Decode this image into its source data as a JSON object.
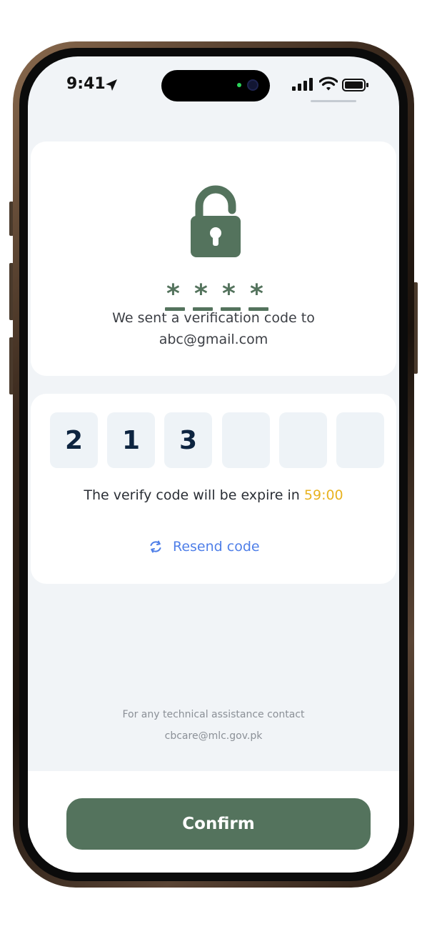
{
  "status_bar": {
    "time": "9:41"
  },
  "verification": {
    "sent_line1": "We sent a verification code to",
    "sent_line2": "abc@gmail.com",
    "mask_chars": [
      "*",
      "*",
      "*",
      "*"
    ]
  },
  "otp": {
    "digits": [
      "2",
      "1",
      "3",
      "",
      "",
      ""
    ],
    "expire_prefix": "The verify code will be expire in",
    "expire_time": "59:00",
    "resend_label": "Resend code"
  },
  "help": {
    "line1": "For any technical assistance contact",
    "line2": "cbcare@mlc.gov.pk"
  },
  "footer": {
    "confirm_label": "Confirm"
  },
  "colors": {
    "accent": "#54735d",
    "timer": "#e8b321",
    "link": "#4f7fe8",
    "screen_bg": "#f1f4f7"
  }
}
